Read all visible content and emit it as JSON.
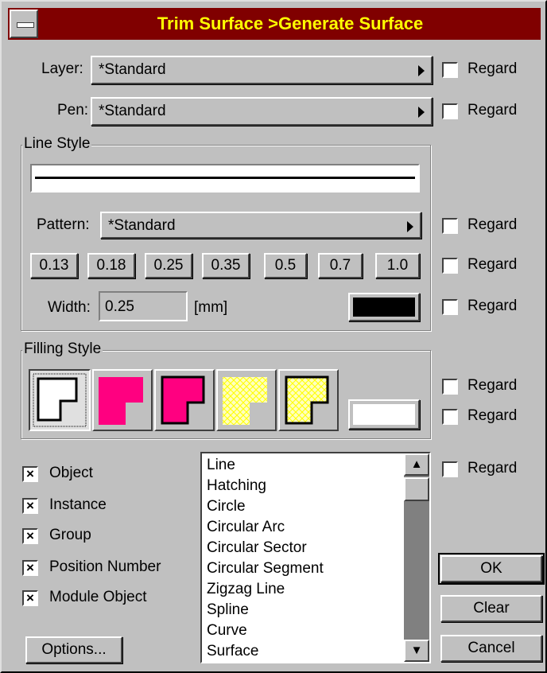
{
  "window": {
    "title": "Trim Surface >Generate Surface"
  },
  "layer": {
    "label": "Layer:",
    "value": "*Standard",
    "regard": "Regard"
  },
  "pen": {
    "label": "Pen:",
    "value": "*Standard",
    "regard": "Regard"
  },
  "line_style": {
    "title": "Line Style",
    "pattern_label": "Pattern:",
    "pattern_value": "*Standard",
    "pattern_regard": "Regard",
    "widths": [
      "0.13",
      "0.18",
      "0.25",
      "0.35",
      "0.5",
      "0.7",
      "1.0"
    ],
    "widths_regard": "Regard",
    "width_label": "Width:",
    "width_value": "0.25",
    "width_unit": "[mm]",
    "color_regard": "Regard",
    "color_swatch": "#000000"
  },
  "filling_style": {
    "title": "Filling Style",
    "regard_1": "Regard",
    "regard_2": "Regard",
    "swatch_color": "#ffffff",
    "accent_magenta": "#ff0080",
    "accent_yellow": "#ffff99"
  },
  "object_types": [
    {
      "label": "Object",
      "checked": true
    },
    {
      "label": "Instance",
      "checked": true
    },
    {
      "label": "Group",
      "checked": true
    },
    {
      "label": "Position Number",
      "checked": true
    },
    {
      "label": "Module Object",
      "checked": true
    }
  ],
  "list": {
    "items": [
      "Line",
      "Hatching",
      "Circle",
      "Circular Arc",
      "Circular Sector",
      "Circular Segment",
      "Zigzag Line",
      "Spline",
      "Curve",
      "Surface"
    ],
    "regard": "Regard"
  },
  "buttons": {
    "options": "Options...",
    "ok": "OK",
    "clear": "Clear",
    "cancel": "Cancel"
  },
  "colors": {
    "title_bg": "#800000",
    "title_text": "#ffff00",
    "face": "#c0c0c0"
  }
}
